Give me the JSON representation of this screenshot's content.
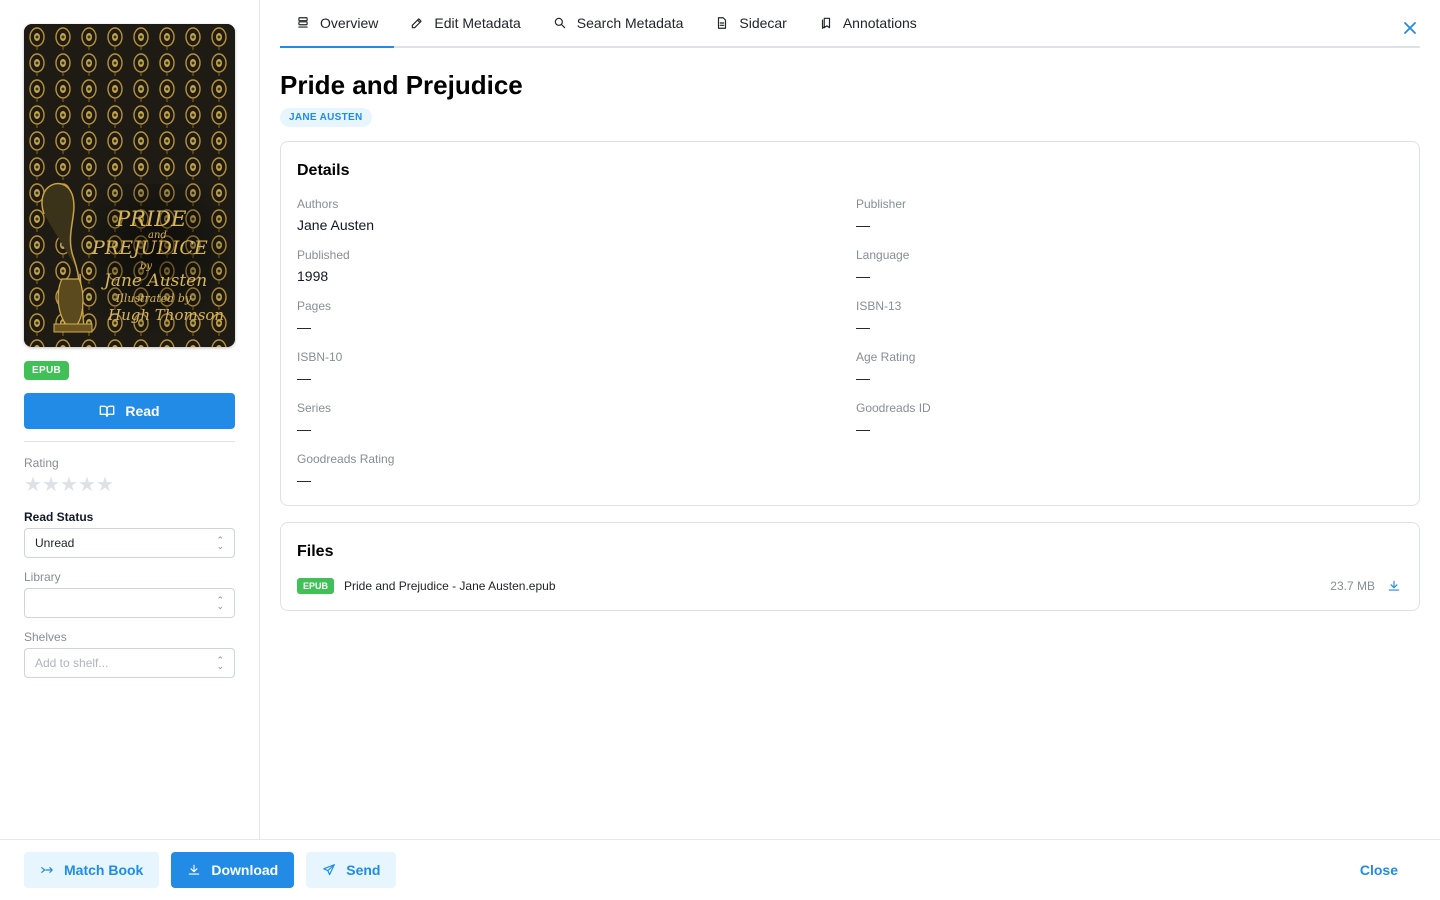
{
  "colors": {
    "accent": "#228be6",
    "accent_light": "#e7f5ff",
    "format_green": "#40c057",
    "muted": "#868e96",
    "border": "#dee2e6"
  },
  "sidebar": {
    "cover_alt": "Book cover",
    "cover_text": {
      "title_line1": "PRIDE",
      "and": "and",
      "title_line2": "PREJUDICE",
      "by": "by",
      "author": "Jane Austen",
      "illustrated_by": "Illustrated by",
      "illustrator": "Hugh Thomson"
    },
    "format_badge": "EPUB",
    "read_button": "Read",
    "rating_label": "Rating",
    "rating_value": 0,
    "rating_max": 5,
    "read_status_label": "Read Status",
    "read_status_value": "Unread",
    "library_label": "Library",
    "library_value": "",
    "shelves_label": "Shelves",
    "shelves_placeholder": "Add to shelf..."
  },
  "tabs": [
    {
      "label": "Overview",
      "icon": "list-icon",
      "active": true
    },
    {
      "label": "Edit Metadata",
      "icon": "pencil-icon",
      "active": false
    },
    {
      "label": "Search Metadata",
      "icon": "search-icon",
      "active": false
    },
    {
      "label": "Sidecar",
      "icon": "file-icon",
      "active": false
    },
    {
      "label": "Annotations",
      "icon": "bookmarks-icon",
      "active": false
    }
  ],
  "book": {
    "title": "Pride and Prejudice",
    "author_badge": "JANE AUSTEN"
  },
  "details": {
    "heading": "Details",
    "fields": [
      {
        "key": "Authors",
        "value": "Jane Austen"
      },
      {
        "key": "Publisher",
        "value": "—"
      },
      {
        "key": "Published",
        "value": "1998"
      },
      {
        "key": "Language",
        "value": "—"
      },
      {
        "key": "Pages",
        "value": "—"
      },
      {
        "key": "ISBN-13",
        "value": "—"
      },
      {
        "key": "ISBN-10",
        "value": "—"
      },
      {
        "key": "Age Rating",
        "value": "—"
      },
      {
        "key": "Series",
        "value": "—"
      },
      {
        "key": "Goodreads ID",
        "value": "—"
      },
      {
        "key": "Goodreads Rating",
        "value": "—"
      }
    ]
  },
  "files": {
    "heading": "Files",
    "items": [
      {
        "format": "EPUB",
        "name": "Pride and Prejudice - Jane Austen.epub",
        "size": "23.7 MB"
      }
    ]
  },
  "footer": {
    "match_book": "Match Book",
    "download": "Download",
    "send": "Send",
    "close": "Close"
  }
}
